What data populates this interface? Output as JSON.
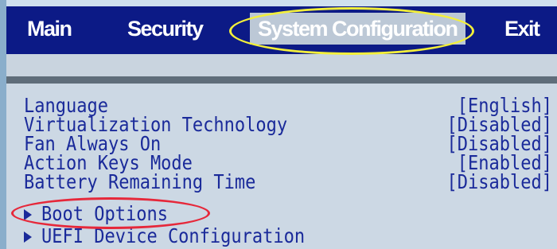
{
  "menu": {
    "tabs": [
      {
        "label": "Main"
      },
      {
        "label": "Security"
      },
      {
        "label": "System Configuration",
        "active": true
      },
      {
        "label": "Exit"
      }
    ]
  },
  "settings": [
    {
      "label": "Language",
      "value": "[English]"
    },
    {
      "label": "Virtualization Technology",
      "value": "[Disabled]"
    },
    {
      "label": "Fan Always On",
      "value": "[Disabled]"
    },
    {
      "label": "Action Keys Mode",
      "value": "[Enabled]"
    },
    {
      "label": "Battery Remaining Time",
      "value": "[Disabled]"
    }
  ],
  "submenus": [
    {
      "label": "Boot Options",
      "icon": "arrow-right-icon"
    },
    {
      "label": "UEFI Device Configuration",
      "icon": "arrow-right-icon"
    }
  ],
  "colors": {
    "menubar_bg": "#0c1a86",
    "panel_bg": "#ccd8e4",
    "text": "#1a2a9a",
    "highlight_yellow": "#f3ef3a",
    "highlight_red": "#e6283a"
  }
}
